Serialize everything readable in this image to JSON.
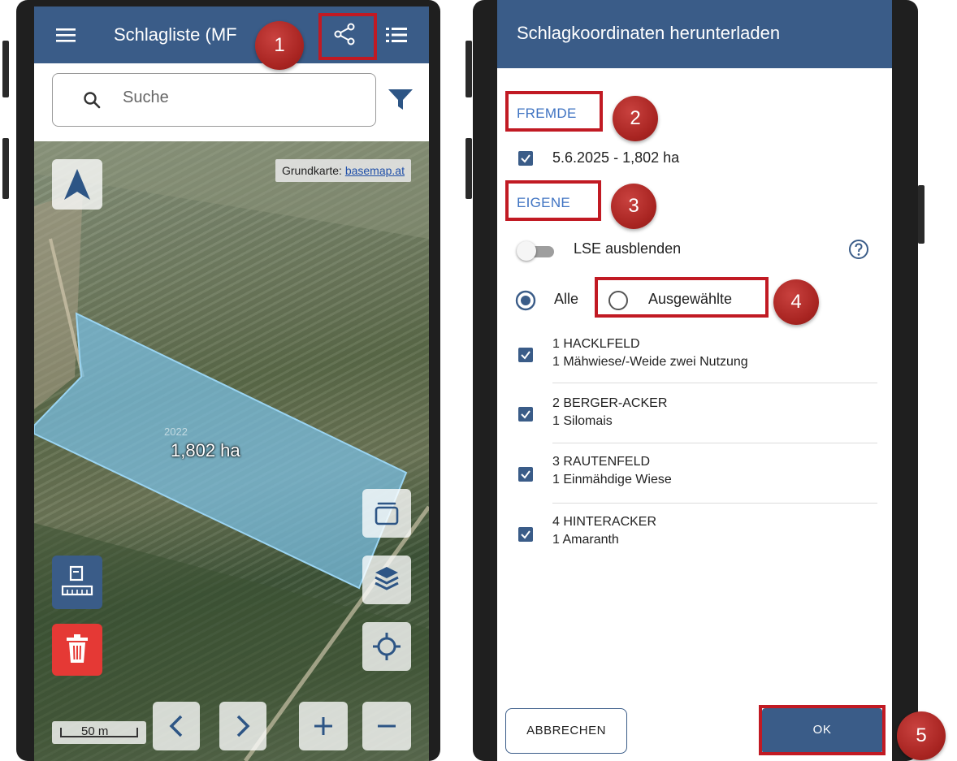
{
  "left_screen": {
    "header": {
      "title": "Schlagliste (MF"
    },
    "search": {
      "placeholder": "Suche"
    },
    "map": {
      "basemap_prefix": "Grundkarte: ",
      "basemap_link": "basemap.at",
      "field_year": "2022",
      "field_area": "1,802 ha",
      "scale": "50 m"
    },
    "icons": [
      "menu-icon",
      "share-icon",
      "list-icon",
      "search-icon",
      "filter-icon",
      "north-arrow-icon",
      "measure-icon",
      "delete-icon",
      "card-icon",
      "layers-icon",
      "locate-icon",
      "prev-icon",
      "next-icon",
      "zoom-in-icon",
      "zoom-out-icon"
    ]
  },
  "right_screen": {
    "title": "Schlagkoordinaten herunterladen",
    "section_foreign": "FREMDE",
    "foreign_item": "5.6.2025 - 1,802 ha",
    "section_own": "EIGENE",
    "toggle_label": "LSE ausblenden",
    "radio_all": "Alle",
    "radio_selected": "Ausgewählte",
    "fields": [
      {
        "title": "1 HACKLFELD",
        "subtitle": "1 Mähwiese/-Weide zwei Nutzung"
      },
      {
        "title": "2 BERGER-ACKER",
        "subtitle": "1 Silomais"
      },
      {
        "title": "3 RAUTENFELD",
        "subtitle": "1 Einmähdige Wiese"
      },
      {
        "title": "4 HINTERACKER",
        "subtitle": "1 Amaranth"
      }
    ],
    "cancel_label": "ABBRECHEN",
    "ok_label": "OK"
  },
  "badges": [
    "1",
    "2",
    "3",
    "4",
    "5"
  ],
  "colors": {
    "primary": "#3a5c88",
    "highlight": "#c11a23",
    "badge": "#a82421",
    "delete": "#e53935",
    "section": "#3f73c2"
  }
}
